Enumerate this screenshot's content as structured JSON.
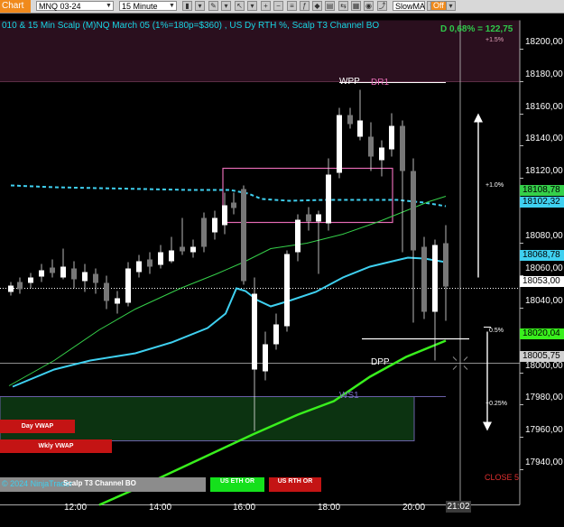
{
  "toolbar": {
    "tab_label": "Chart",
    "instrument": "MNQ 03-24",
    "interval": "15 Minute",
    "indicator_select": "SlowMA",
    "off_label": "Off"
  },
  "chart": {
    "title": "010 & 15 Min Scalp (M)NQ March 05 (1%=180p=$360) , US Dy RTH %, Scalp T3 Channel BO",
    "change_label": "D 0,68% = 122,75",
    "colors": {
      "background": "#000000",
      "cyan_ma": "#3fd0f0",
      "green_ma": "#35d04a",
      "lime_ma": "#39ef1d",
      "box_pink": "#e46bb4",
      "top_band": "#2a0f1e",
      "ws1_band": "#0c3311"
    }
  },
  "axis": {
    "prices": [
      "18200,00",
      "18180,00",
      "18160,00",
      "18140,00",
      "18120,00",
      "18080,00",
      "18060,00",
      "18040,00",
      "18000,00",
      "17980,00",
      "17960,00",
      "17940,00"
    ],
    "times": [
      "12:00",
      "14:00",
      "16:00",
      "18:00",
      "20:00"
    ],
    "current_time": "21:02"
  },
  "price_tags": [
    {
      "value": "18108,78",
      "color": "#35d04a"
    },
    {
      "value": "18102,32",
      "color": "#3fd0f0"
    },
    {
      "value": "18068,78",
      "color": "#3fd0f0"
    },
    {
      "value": "18053,00",
      "color": "#ffffff"
    },
    {
      "value": "18020,04",
      "color": "#39ef1d"
    },
    {
      "value": "18005,75",
      "color": "#d0d0d0"
    }
  ],
  "levels": {
    "wpp": "WPP",
    "dr1": "DR1",
    "dpp": "DPP",
    "ws1": "WS1"
  },
  "percent_labels": {
    "p15": "+1.5%",
    "p10": "+1.0%",
    "p05": "0.5%",
    "p025": "+0.25%"
  },
  "buttons": {
    "day_vwap": "Day VWAP",
    "wkly_vwap": "Wkly VWAP",
    "copyright": "© 2024 NinjaTrader",
    "scalp_t3": "Scalp T3 Channel BO",
    "us_eth_or": "US ETH OR",
    "us_rth_or": "US RTH OR"
  },
  "close_label": "CLOSE 5"
}
